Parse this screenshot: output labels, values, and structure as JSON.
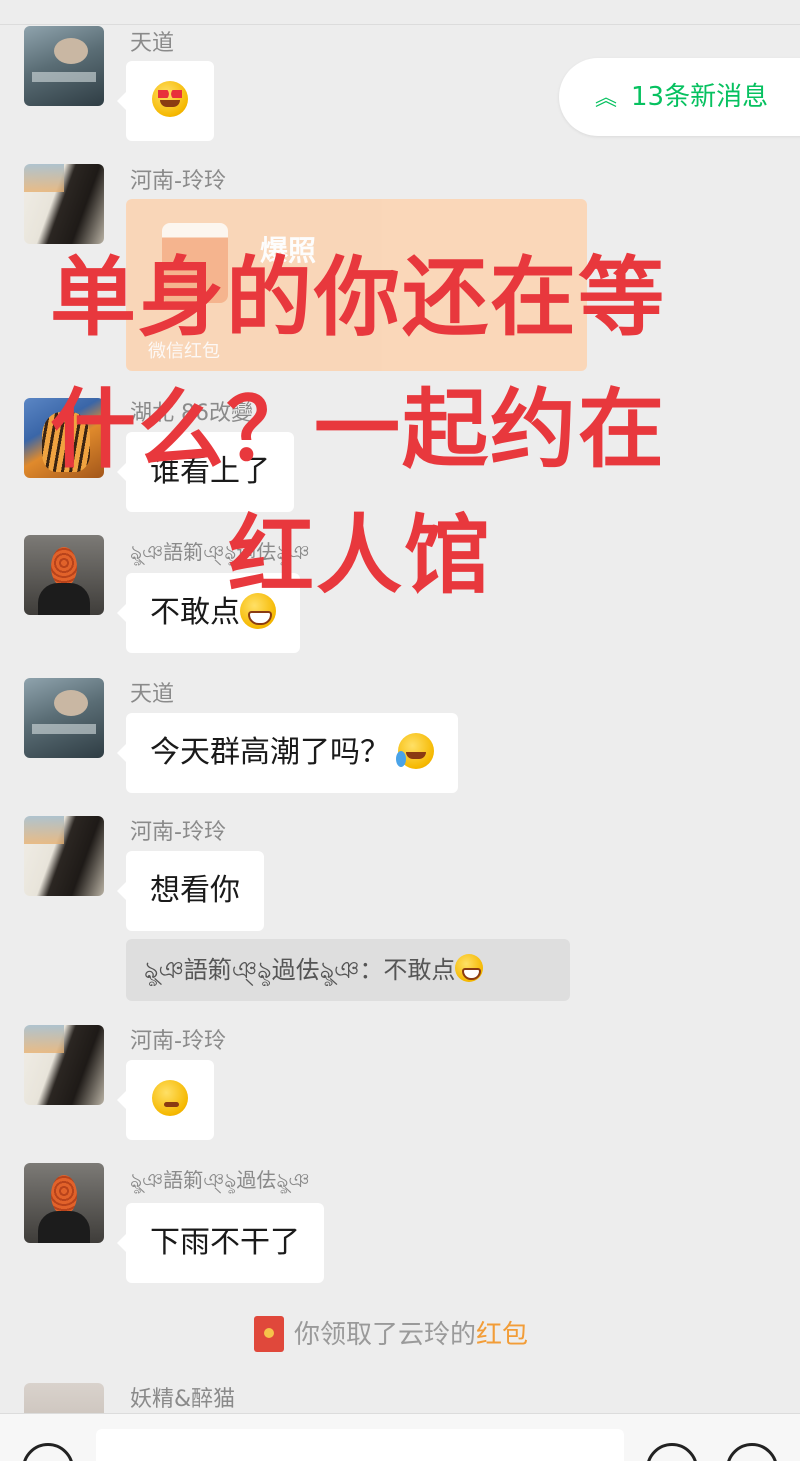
{
  "new_messages": {
    "label": "13条新消息"
  },
  "messages": [
    {
      "sender": "天道",
      "text": ""
    },
    {
      "sender": "河南-玲玲",
      "packet_title": "爆照",
      "packet_footer": "微信红包"
    },
    {
      "sender": "湖北 86改變",
      "text": "谁看上了"
    },
    {
      "sender": "ৡ্ঞ語箣ঞ্ৡ過佉ৡ্ঞ",
      "text": "不敢点"
    },
    {
      "sender": "天道",
      "text": "今天群高潮了吗？"
    },
    {
      "sender": "河南-玲玲",
      "text": "想看你",
      "quote": "ৡ্ঞ語箣ঞ্ৡ過佉ৡ্ঞ：不敢点"
    },
    {
      "sender": "河南-玲玲",
      "text": ""
    },
    {
      "sender": "ৡ্ঞ語箣ঞ্ৡ過佉ৡ্ঞ",
      "text": "下雨不干了"
    },
    {
      "sender": "妖精&醉猫",
      "text": ""
    }
  ],
  "system_message": {
    "prefix": "你领取了云玲的",
    "link": "红包"
  },
  "overlay": {
    "lines": [
      "单身的你还在等",
      "什么？一起约在",
      "红人馆"
    ],
    "color": "#e8383d"
  },
  "colors": {
    "accent": "#07c160",
    "bubble": "#ffffff",
    "background": "#ededed"
  },
  "icons": [
    "double-chevron-up-icon",
    "red-packet-icon",
    "voice-icon",
    "emoji-face-icon",
    "plus-icon"
  ]
}
